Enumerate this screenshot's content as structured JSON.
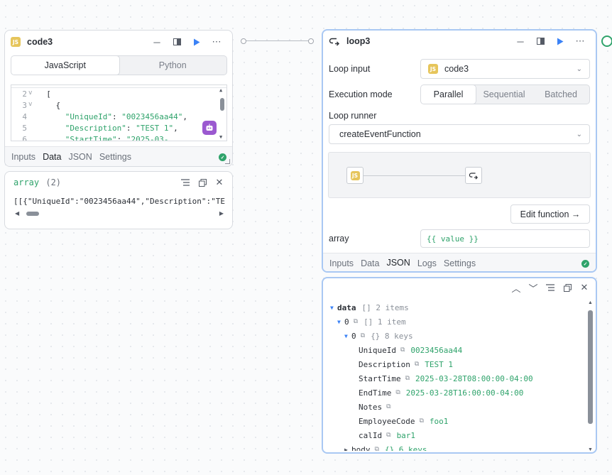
{
  "code_node": {
    "title": "code3",
    "badge": "JS",
    "lang_tabs": [
      "JavaScript",
      "Python"
    ],
    "active_lang": "JavaScript",
    "code_lines": [
      {
        "num": "2",
        "fold": "v",
        "text": "  ["
      },
      {
        "num": "3",
        "fold": "v",
        "text": "    {"
      },
      {
        "num": "4",
        "fold": "",
        "key": "      \"UniqueId\"",
        "sep": ": ",
        "val": "\"0023456aa44\"",
        "end": ","
      },
      {
        "num": "5",
        "fold": "",
        "key": "      \"Description\"",
        "sep": ": ",
        "val": "\"TEST 1\"",
        "end": ","
      },
      {
        "num": "6",
        "fold": "",
        "key": "      \"StartTime\"",
        "sep": ": ",
        "val": "\"2025-03-",
        "end": ""
      }
    ],
    "tabs": [
      "Inputs",
      "Data",
      "JSON",
      "Settings"
    ],
    "active_tab": "Data"
  },
  "array_panel": {
    "label": "array",
    "count": "(2)",
    "value": "[[{\"UniqueId\":\"0023456aa44\",\"Description\":\"TE"
  },
  "loop_node": {
    "title": "loop3",
    "loop_input_label": "Loop input",
    "loop_input_value": "code3",
    "loop_input_badge": "JS",
    "execution_mode_label": "Execution mode",
    "modes": [
      "Parallel",
      "Sequential",
      "Batched"
    ],
    "active_mode": "Parallel",
    "loop_runner_label": "Loop runner",
    "loop_runner_value": "createEventFunction",
    "edit_function_label": "Edit function →",
    "array_label": "array",
    "array_value": "{{ value }}",
    "tabs": [
      "Inputs",
      "Data",
      "JSON",
      "Logs",
      "Settings"
    ],
    "active_tab": "JSON"
  },
  "json_output": {
    "rows": [
      {
        "indent": 0,
        "toggle": "▼",
        "key": "data",
        "bold": true,
        "meta": "[]  2 items",
        "value": ""
      },
      {
        "indent": 1,
        "toggle": "▼",
        "key": "0",
        "copy": true,
        "meta": "[]  1 item",
        "value": ""
      },
      {
        "indent": 2,
        "toggle": "▼",
        "key": "0",
        "copy": true,
        "meta": "{}  8 keys",
        "value": ""
      },
      {
        "indent": 3,
        "toggle": "",
        "key": "UniqueId",
        "copy": true,
        "meta": "",
        "value": "0023456aa44"
      },
      {
        "indent": 3,
        "toggle": "",
        "key": "Description",
        "copy": true,
        "meta": "",
        "value": "TEST 1"
      },
      {
        "indent": 3,
        "toggle": "",
        "key": "StartTime",
        "copy": true,
        "meta": "",
        "value": "2025-03-28T08:00:00-04:00"
      },
      {
        "indent": 3,
        "toggle": "",
        "key": "EndTime",
        "copy": true,
        "meta": "",
        "value": "2025-03-28T16:00:00-04:00"
      },
      {
        "indent": 3,
        "toggle": "",
        "key": "Notes",
        "copy": true,
        "meta": "",
        "value": ""
      },
      {
        "indent": 3,
        "toggle": "",
        "key": "EmployeeCode",
        "copy": true,
        "meta": "",
        "value": "foo1"
      },
      {
        "indent": 3,
        "toggle": "",
        "key": "calId",
        "copy": true,
        "meta": "",
        "value": "bar1"
      },
      {
        "indent": 2,
        "toggle": "▶",
        "key": "body",
        "copy": true,
        "meta": "",
        "value": "{}  6 keys"
      }
    ]
  },
  "colors": {
    "accent_blue": "#3b82f6",
    "success_green": "#2fa36b",
    "js_badge": "#e6c55b",
    "selected_border": "#a9c8f3"
  }
}
